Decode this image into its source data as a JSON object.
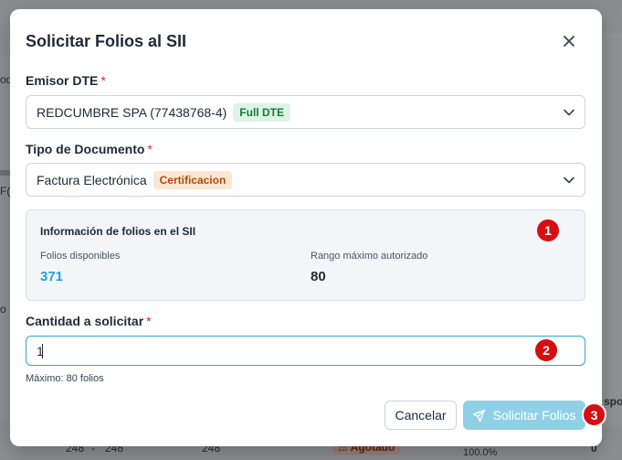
{
  "background": {
    "fragments": {
      "left_top": "od",
      "left_mid": "F(",
      "left_row": "o",
      "right_header": "spo",
      "row_a": "248",
      "row_dash": "-",
      "row_b": "248",
      "row_c": "248",
      "badge": "⚠ Agotado",
      "percent": "100.0%",
      "zero": "0"
    }
  },
  "modal": {
    "title": "Solicitar Folios al SII",
    "emisor": {
      "label": "Emisor DTE",
      "required_mark": "*",
      "value": "REDCUMBRE SPA (77438768-4)",
      "tag": "Full DTE"
    },
    "tipo_documento": {
      "label": "Tipo de Documento",
      "required_mark": "*",
      "value": "Factura Electrónica",
      "tag": "Certificacion"
    },
    "info": {
      "title": "Información de folios en el SII",
      "disponibles_label": "Folios disponibles",
      "disponibles_value": "371",
      "rango_label": "Rango máximo autorizado",
      "rango_value": "80"
    },
    "cantidad": {
      "label": "Cantidad a solicitar",
      "required_mark": "*",
      "value": "1",
      "hint": "Máximo: 80 folios"
    },
    "buttons": {
      "cancel": "Cancelar",
      "submit": "Solicitar Folios"
    }
  },
  "annotations": {
    "step1": "1",
    "step2": "2",
    "step3": "3"
  },
  "colors": {
    "accent": "#2ea8c9",
    "submit_disabled": "#8fd0e6",
    "badge_red": "#d50f0f",
    "tag_green_text": "#157a3b",
    "tag_orange_text": "#b4470e"
  }
}
